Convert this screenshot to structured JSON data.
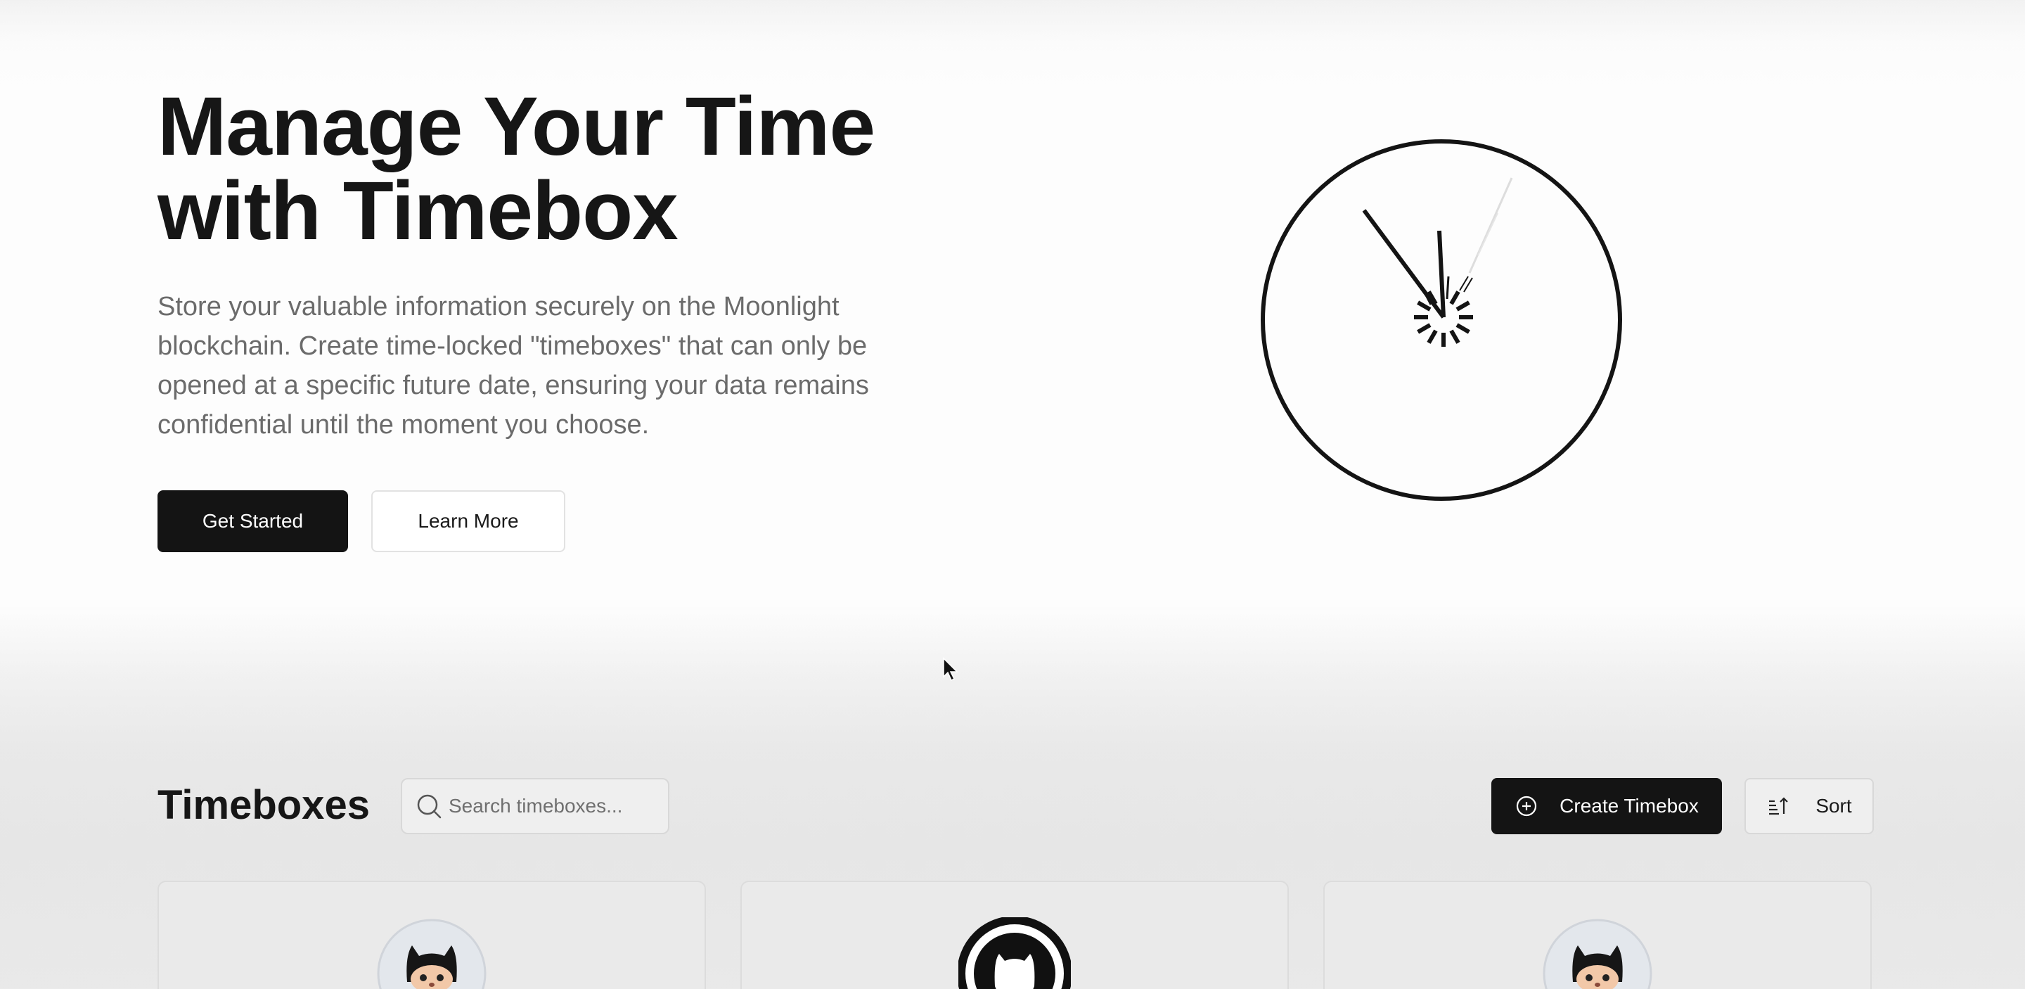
{
  "hero": {
    "title_line1": "Manage Your Time",
    "title_line2": "with Timebox",
    "description": "Store your valuable information securely on the Moonlight blockchain. Create time-locked \"timeboxes\" that can only be opened at a specific future date, ensuring your data remains confidential until the moment you choose.",
    "primary_button": "Get Started",
    "secondary_button": "Learn More"
  },
  "timeboxes": {
    "title": "Timeboxes",
    "search_placeholder": "Search timeboxes...",
    "create_button": "Create Timebox",
    "sort_button": "Sort"
  },
  "cards": [
    {
      "avatar_icon": "github-octocat-icon"
    },
    {
      "avatar_icon": "github-logo-icon"
    },
    {
      "avatar_icon": "github-octocat-icon"
    }
  ],
  "icons": {
    "clock": "clock-icon",
    "search": "search-icon",
    "create": "plus-circle-icon",
    "sort": "sort-ascending-icon",
    "cursor": "mouse-pointer-icon"
  },
  "colors": {
    "primary": "#141414",
    "text_muted": "#6b6b6b",
    "border": "#dcdcdc"
  }
}
